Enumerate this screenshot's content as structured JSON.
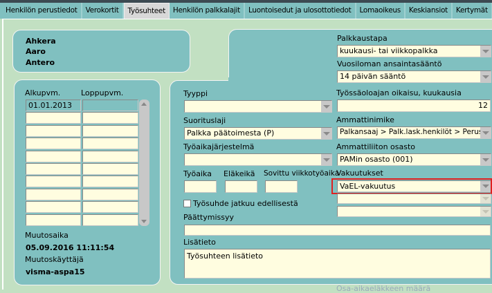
{
  "tabs": [
    "Henkilön perustiedot",
    "Verokortit",
    "Työsuhteet",
    "Henkilön palkkalajit",
    "Luontoisedut ja ulosottotiedot",
    "Lomaoikeus",
    "Keskiansiot",
    "Kertymät"
  ],
  "active_tab": "Työsuhteet",
  "person": {
    "last_name": "Ahkera",
    "first_name": "Aaro",
    "middle_name": "Antero"
  },
  "list": {
    "col1": "Alkupvm.",
    "col2": "Loppupvm.",
    "rows": [
      [
        "01.01.2013",
        ""
      ],
      [
        "",
        ""
      ],
      [
        "",
        ""
      ],
      [
        "",
        ""
      ],
      [
        "",
        ""
      ],
      [
        "",
        ""
      ],
      [
        "",
        ""
      ],
      [
        "",
        ""
      ],
      [
        "",
        ""
      ],
      [
        "",
        ""
      ]
    ],
    "changed_label": "Muutosaika",
    "changed_value": "05.09.2016 11:11:54",
    "user_label": "Muutoskäyttäjä",
    "user_value": "visma-aspa15"
  },
  "form": {
    "palkkaustapa_label": "Palkkaustapa",
    "palkkaustapa": "kuukausi- tai viikkopalkka",
    "vuosiloma_label": "Vuosiloman ansaintasääntö",
    "vuosiloma": "14 päivän sääntö",
    "tyyppi_label": "Tyyppi",
    "tyyppi": "",
    "tyossaolo_label": "Työssäoloajan oikaisu, kuukausia",
    "tyossaolo": "12",
    "suorituslaji_label": "Suorituslaji",
    "suorituslaji": "Palkka päätoimesta (P)",
    "ammattinimike_label": "Ammattinimike",
    "ammattinimike": "Palkansaaj > Palk.lask.henkilöt > Perusti...",
    "tyoaikajarjestelma_label": "Työaikajärjestelmä",
    "tyoaikajarjestelma": "",
    "osasto_label": "Ammattiliiton osasto",
    "osasto": "PAMin osasto (001)",
    "tyoaika_label": "Työaika",
    "elakeika_label": "Eläkeikä",
    "sovittu_label": "Sovittu viikkotyöaika",
    "vakuutukset_label": "Vakuutukset",
    "vakuutus1": "VaEL-vakuutus",
    "jatkuu_label": "Työsuhde jatkuu edellisestä",
    "jatkuu_checked": false,
    "paattymissyy_label": "Päättymissyy",
    "paattymissyy": "",
    "lisatieto_label": "Lisätieto",
    "lisatieto": "Työsuhteen lisätieto",
    "osa_aika_label": "Osa-aikaeläkkeen määrä"
  }
}
